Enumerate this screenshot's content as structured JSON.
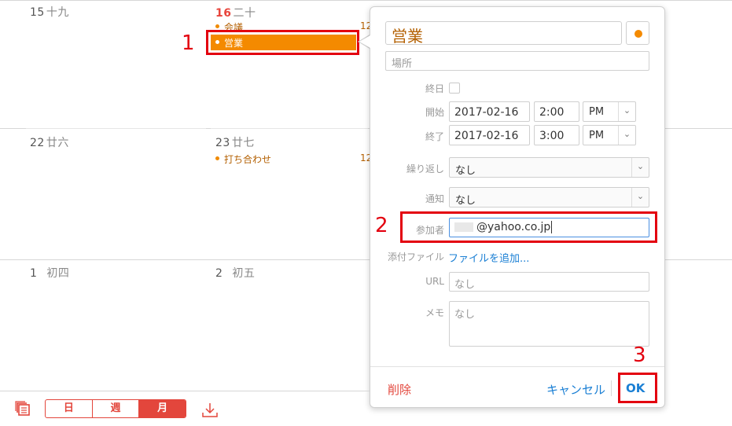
{
  "calendar": {
    "week1": [
      {
        "day": "15",
        "lunar": "十九"
      },
      {
        "day": "16",
        "lunar": "二十"
      }
    ],
    "week2": [
      {
        "day": "22",
        "lunar": "廿六"
      },
      {
        "day": "23",
        "lunar": "廿七"
      }
    ],
    "week3": [
      {
        "day": "1",
        "lunar": "初四"
      },
      {
        "day": "2",
        "lunar": "初五"
      }
    ],
    "events": {
      "meeting": "会議",
      "sales": "営業",
      "uchiawase": "打ち合わせ",
      "time_partial": "12"
    }
  },
  "annotations": {
    "one": "1",
    "two": "2",
    "three": "3"
  },
  "popover": {
    "title": "営業",
    "location_placeholder": "場所",
    "allday_label": "終日",
    "start_label": "開始",
    "end_label": "終了",
    "start_date": "2017-02-16",
    "start_time": "2:00",
    "start_ampm": "PM",
    "end_date": "2017-02-16",
    "end_time": "3:00",
    "end_ampm": "PM",
    "repeat_label": "繰り返し",
    "repeat_value": "なし",
    "alert_label": "通知",
    "alert_value": "なし",
    "invitees_label": "参加者",
    "invitee_value": "@yahoo.co.jp",
    "attachment_label": "添付ファイル",
    "attachment_link": "ファイルを追加...",
    "url_label": "URL",
    "url_placeholder": "なし",
    "memo_label": "メモ",
    "memo_placeholder": "なし",
    "delete_label": "削除",
    "cancel_label": "キャンセル",
    "ok_label": "OK"
  },
  "toolbar": {
    "day_label": "日",
    "week_label": "週",
    "month_label": "月",
    "active": "月"
  },
  "colors": {
    "accent": "#e3463c",
    "event": "#f48a00",
    "annotation": "#e3000f",
    "link": "#1a7fd4"
  },
  "icons": [
    "calendar-list-icon",
    "download-icon",
    "chevron-down-icon",
    "color-dot-icon"
  ]
}
